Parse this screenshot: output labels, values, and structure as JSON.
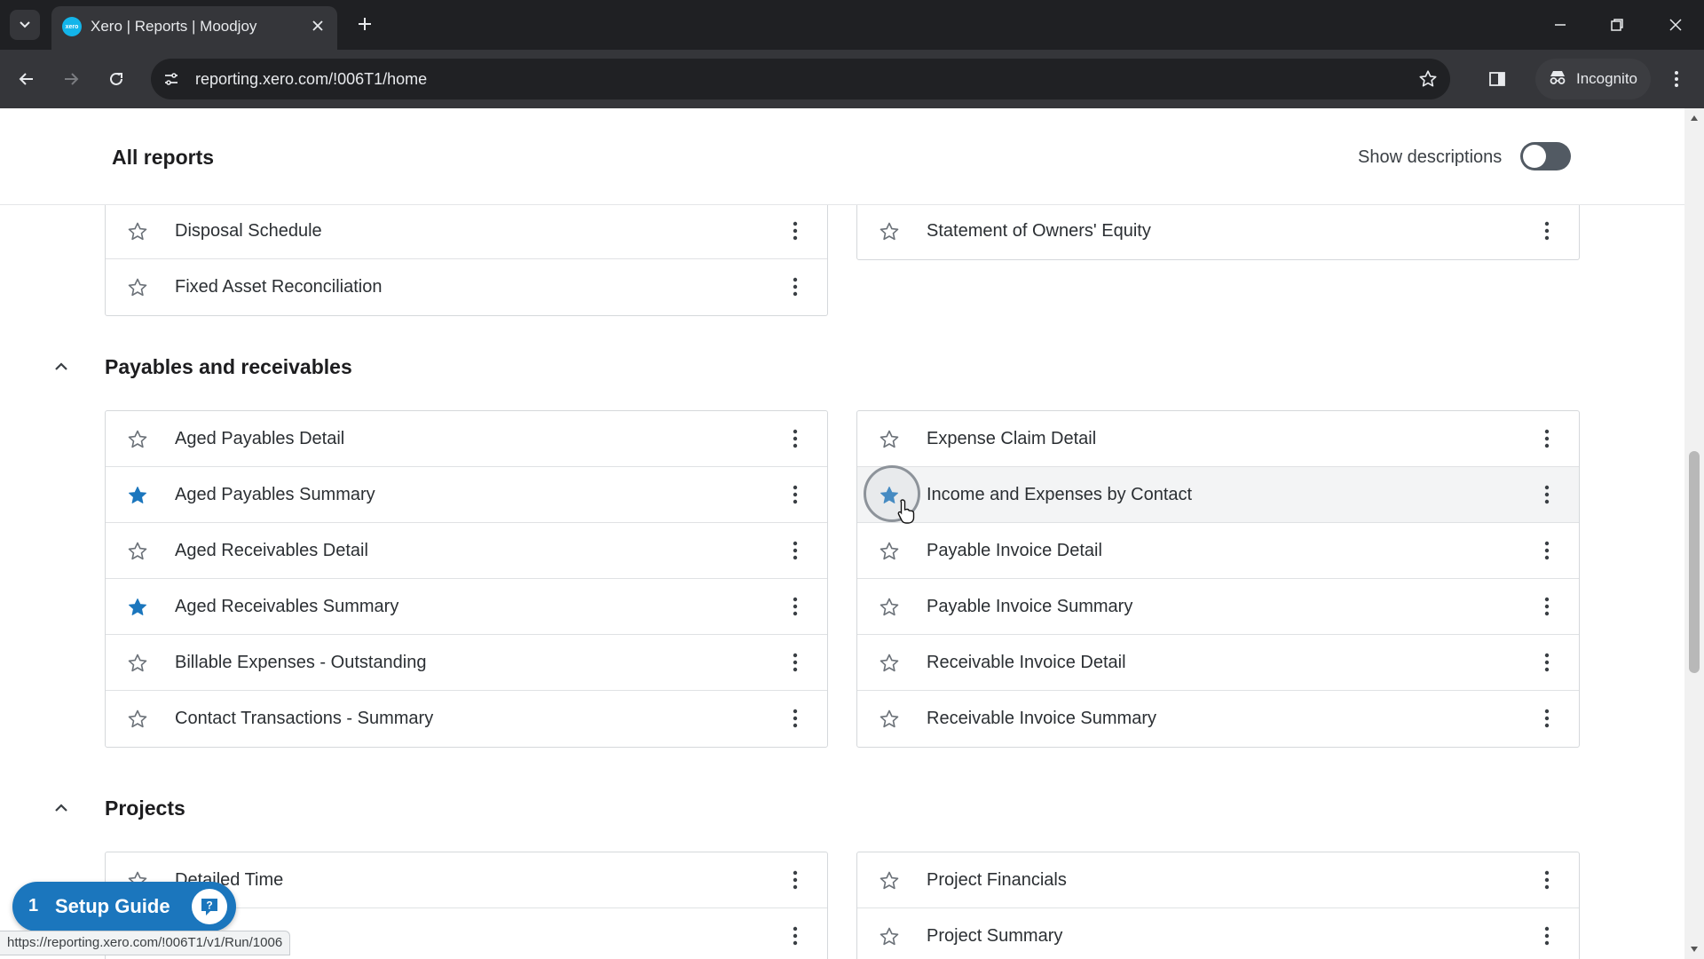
{
  "browser": {
    "tab_title": "Xero | Reports | Moodjoy",
    "favicon_text": "xero",
    "url": "reporting.xero.com/!006T1/home",
    "incognito_label": "Incognito",
    "status_url": "https://reporting.xero.com/!006T1/v1/Run/1006"
  },
  "header": {
    "title": "All reports",
    "show_descriptions_label": "Show descriptions",
    "show_descriptions_on": false
  },
  "sections": {
    "top": {
      "left": [
        {
          "label": "Disposal Schedule",
          "starred": false
        },
        {
          "label": "Fixed Asset Reconciliation",
          "starred": false
        }
      ],
      "right": [
        {
          "label": "Statement of Owners' Equity",
          "starred": false
        }
      ]
    },
    "payables": {
      "title": "Payables and receivables",
      "left": [
        {
          "label": "Aged Payables Detail",
          "starred": false
        },
        {
          "label": "Aged Payables Summary",
          "starred": true
        },
        {
          "label": "Aged Receivables Detail",
          "starred": false
        },
        {
          "label": "Aged Receivables Summary",
          "starred": true
        },
        {
          "label": "Billable Expenses - Outstanding",
          "starred": false
        },
        {
          "label": "Contact Transactions - Summary",
          "starred": false
        }
      ],
      "right": [
        {
          "label": "Expense Claim Detail",
          "starred": false
        },
        {
          "label": "Income and Expenses by Contact",
          "starred": true
        },
        {
          "label": "Payable Invoice Detail",
          "starred": false
        },
        {
          "label": "Payable Invoice Summary",
          "starred": false
        },
        {
          "label": "Receivable Invoice Detail",
          "starred": false
        },
        {
          "label": "Receivable Invoice Summary",
          "starred": false
        }
      ]
    },
    "projects": {
      "title": "Projects",
      "left": [
        {
          "label": "Detailed Time",
          "starred": false
        },
        {
          "label": "",
          "starred": false
        }
      ],
      "right": [
        {
          "label": "Project Financials",
          "starred": false
        },
        {
          "label": "Project Summary",
          "starred": false
        }
      ]
    }
  },
  "setup_guide": {
    "count": "1",
    "label": "Setup Guide"
  },
  "colors": {
    "star_filled": "#1b76bd",
    "star_outline": "#6b7178",
    "setup_bg": "#1b76bd"
  },
  "icons": [
    "tab-search-icon",
    "close-icon",
    "plus-icon",
    "minimize-icon",
    "restore-icon",
    "back-icon",
    "forward-icon",
    "reload-icon",
    "site-info-icon",
    "bookmark-star-icon",
    "side-panel-icon",
    "incognito-icon",
    "menu-dots-icon",
    "star-icon",
    "kebab-icon",
    "chevron-up-icon",
    "help-icon"
  ]
}
